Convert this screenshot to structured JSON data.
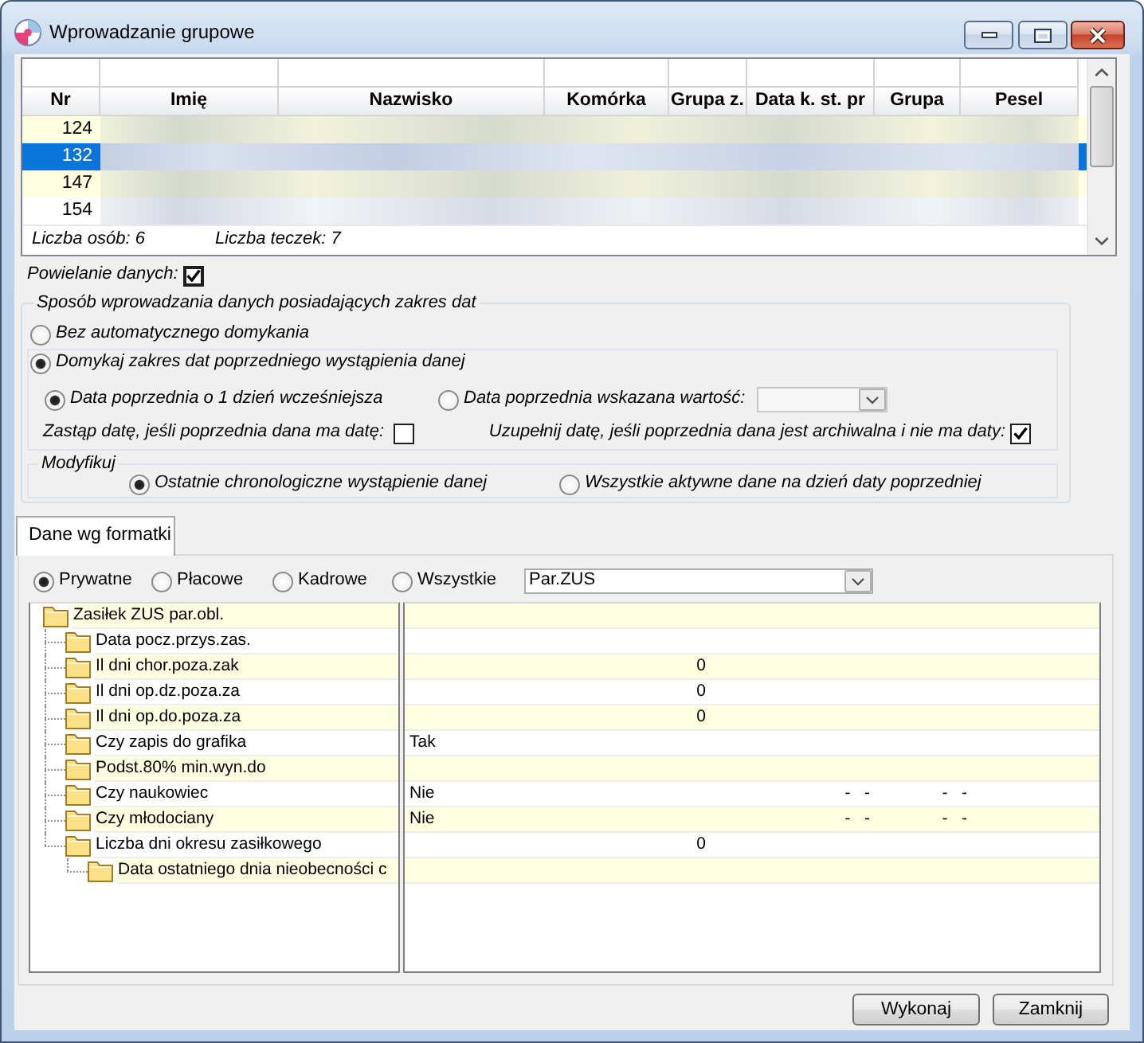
{
  "window": {
    "title": "Wprowadzanie grupowe"
  },
  "table": {
    "columns": [
      "Nr",
      "Imię",
      "Nazwisko",
      "Komórka",
      "Grupa z.",
      "Data k. st. pr",
      "Grupa",
      "Pesel"
    ],
    "rows": [
      {
        "nr": "124",
        "selected": false
      },
      {
        "nr": "132",
        "selected": true
      },
      {
        "nr": "147",
        "selected": false
      },
      {
        "nr": "154",
        "selected": false
      }
    ],
    "summary": [
      "Liczba osób: 6",
      "Liczba teczek: 7"
    ]
  },
  "duplicate_data": {
    "label": "Powielanie danych:",
    "checked": true
  },
  "date_range_group": {
    "title": "Sposób wprowadzania danych posiadających zakres dat",
    "modes": [
      {
        "label": "Bez automatycznego domykania",
        "selected": false
      },
      {
        "label": "Domykaj zakres dat poprzedniego wystąpienia danej",
        "selected": true
      }
    ],
    "previous_date": [
      {
        "label": "Data poprzednia o 1 dzień wcześniejsza",
        "selected": true
      },
      {
        "label": "Data poprzednia wskazana wartość:",
        "selected": false
      }
    ],
    "previous_date_dropdown": {
      "disabled": true
    },
    "options": [
      {
        "label": "Zastąp datę, jeśli poprzednia dana ma datę:",
        "checked": false
      },
      {
        "label": "Uzupełnij datę, jeśli poprzednia dana jest archiwalna i nie ma daty:",
        "checked": true
      }
    ],
    "modify": {
      "title": "Modyfikuj",
      "options": [
        {
          "label": "Ostatnie chronologiczne wystąpienie danej",
          "selected": true
        },
        {
          "label": "Wszystkie aktywne dane na dzień daty poprzedniej",
          "selected": false
        }
      ]
    }
  },
  "tabs": [
    {
      "label": "Dane wg formatki",
      "selected": true
    }
  ],
  "data_scope": [
    {
      "label": "Prywatne",
      "selected": true
    },
    {
      "label": "Płacowe",
      "selected": false
    },
    {
      "label": "Kadrowe",
      "selected": false
    },
    {
      "label": "Wszystkie",
      "selected": false
    }
  ],
  "form_dropdown": {
    "value": "Par.ZUS"
  },
  "tree": [
    {
      "label": "Zasiłek ZUS par.obl.",
      "children": [
        {
          "label": "Data pocz.przys.zas."
        },
        {
          "label": "Il dni chor.poza.zak",
          "column_2": "0"
        },
        {
          "label": "Il dni op.dz.poza.za",
          "column_2": "0"
        },
        {
          "label": "Il dni op.do.poza.za",
          "column_2": "0"
        },
        {
          "label": "Czy zapis do grafika",
          "column_1": "Tak"
        },
        {
          "label": "Podst.80% min.wyn.do"
        },
        {
          "label": "Czy naukowiec",
          "column_1": "Nie",
          "column_3": "-   -",
          "column_4": "-   -"
        },
        {
          "label": "Czy młodociany",
          "column_1": "Nie",
          "column_3": "-   -",
          "column_4": "-   -"
        },
        {
          "label": "Liczba dni okresu zasiłkowego",
          "column_2": "0",
          "children": [
            {
              "label": "Data ostatniego dnia nieobecności c"
            }
          ]
        }
      ]
    }
  ],
  "buttons": [
    "Wykonaj",
    "Zamknij"
  ]
}
